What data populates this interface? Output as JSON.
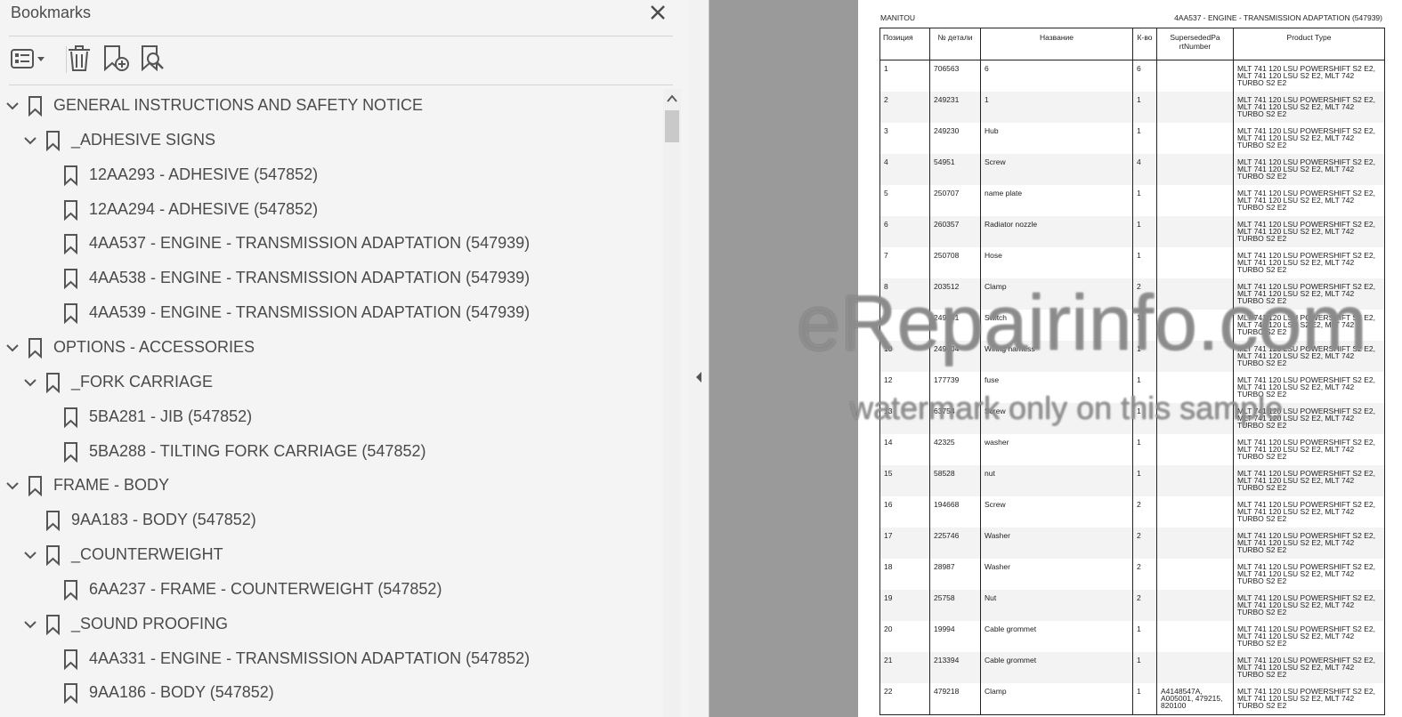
{
  "sidebar": {
    "title": "Bookmarks",
    "toolbar": {
      "options_icon": "list-options-icon",
      "delete_icon": "trash-icon",
      "add_icon": "bookmark-add-icon",
      "find_icon": "bookmark-find-icon"
    },
    "items": [
      {
        "level": 0,
        "expandable": true,
        "label": "GENERAL INSTRUCTIONS AND SAFETY NOTICE"
      },
      {
        "level": 1,
        "expandable": true,
        "label": "_ADHESIVE SIGNS"
      },
      {
        "level": 2,
        "expandable": false,
        "label": "12AA293 - ADHESIVE (547852)"
      },
      {
        "level": 2,
        "expandable": false,
        "label": "12AA294 - ADHESIVE (547852)"
      },
      {
        "level": 2,
        "expandable": false,
        "label": "4AA537 - ENGINE - TRANSMISSION ADAPTATION (547939)"
      },
      {
        "level": 2,
        "expandable": false,
        "label": "4AA538 - ENGINE - TRANSMISSION ADAPTATION (547939)"
      },
      {
        "level": 2,
        "expandable": false,
        "label": "4AA539 - ENGINE - TRANSMISSION ADAPTATION (547939)"
      },
      {
        "level": 0,
        "expandable": true,
        "label": "OPTIONS - ACCESSORIES"
      },
      {
        "level": 1,
        "expandable": true,
        "label": "_FORK CARRIAGE"
      },
      {
        "level": 2,
        "expandable": false,
        "label": "5BA281 - JIB (547852)"
      },
      {
        "level": 2,
        "expandable": false,
        "label": "5BA288 - TILTING FORK CARRIAGE (547852)"
      },
      {
        "level": 0,
        "expandable": true,
        "label": "FRAME - BODY"
      },
      {
        "level": 1,
        "expandable": false,
        "label": "9AA183 - BODY (547852)"
      },
      {
        "level": 1,
        "expandable": true,
        "label": "_COUNTERWEIGHT"
      },
      {
        "level": 2,
        "expandable": false,
        "label": "6AA237 - FRAME - COUNTERWEIGHT (547852)"
      },
      {
        "level": 1,
        "expandable": true,
        "label": "_SOUND PROOFING"
      },
      {
        "level": 2,
        "expandable": false,
        "label": "4AA331 - ENGINE - TRANSMISSION ADAPTATION (547852)"
      },
      {
        "level": 2,
        "expandable": false,
        "label": "9AA186 - BODY (547852)"
      }
    ]
  },
  "document": {
    "header_left": "MANITOU",
    "header_right": "4AA537 - ENGINE - TRANSMISSION ADAPTATION (547939)",
    "columns": [
      "Позиция",
      "№ детали",
      "Название",
      "К-во",
      "SupersededPa rtNumber",
      "Product Type"
    ],
    "rows": [
      [
        "1",
        "706563",
        "6",
        "6",
        "",
        "MLT 741 120 LSU POWERSHIFT S2 E2, MLT 741 120 LSU S2 E2, MLT 742 TURBO S2 E2"
      ],
      [
        "2",
        "249231",
        "1",
        "1",
        "",
        "MLT 741 120 LSU POWERSHIFT S2 E2, MLT 741 120 LSU S2 E2, MLT 742 TURBO S2 E2"
      ],
      [
        "3",
        "249230",
        "Hub",
        "1",
        "",
        "MLT 741 120 LSU POWERSHIFT S2 E2, MLT 741 120 LSU S2 E2, MLT 742 TURBO S2 E2"
      ],
      [
        "4",
        "54951",
        "Screw",
        "4",
        "",
        "MLT 741 120 LSU POWERSHIFT S2 E2, MLT 741 120 LSU S2 E2, MLT 742 TURBO S2 E2"
      ],
      [
        "5",
        "250707",
        "name plate",
        "1",
        "",
        "MLT 741 120 LSU POWERSHIFT S2 E2, MLT 741 120 LSU S2 E2, MLT 742 TURBO S2 E2"
      ],
      [
        "6",
        "260357",
        "Radiator nozzle",
        "1",
        "",
        "MLT 741 120 LSU POWERSHIFT S2 E2, MLT 741 120 LSU S2 E2, MLT 742 TURBO S2 E2"
      ],
      [
        "7",
        "250708",
        "Hose",
        "1",
        "",
        "MLT 741 120 LSU POWERSHIFT S2 E2, MLT 741 120 LSU S2 E2, MLT 742 TURBO S2 E2"
      ],
      [
        "8",
        "203512",
        "Clamp",
        "2",
        "",
        "MLT 741 120 LSU POWERSHIFT S2 E2, MLT 741 120 LSU S2 E2, MLT 742 TURBO S2 E2"
      ],
      [
        "9",
        "249341",
        "Switch",
        "1",
        "",
        "MLT 741 120 LSU POWERSHIFT S2 E2, MLT 741 120 LSU S2 E2, MLT 742 TURBO S2 E2"
      ],
      [
        "10",
        "249404",
        "Wiring harness",
        "1",
        "",
        "MLT 741 120 LSU POWERSHIFT S2 E2, MLT 741 120 LSU S2 E2, MLT 742 TURBO S2 E2"
      ],
      [
        "12",
        "177739",
        "fuse",
        "1",
        "",
        "MLT 741 120 LSU POWERSHIFT S2 E2, MLT 741 120 LSU S2 E2, MLT 742 TURBO S2 E2"
      ],
      [
        "13",
        "63754",
        "Screw",
        "1",
        "",
        "MLT 741 120 LSU POWERSHIFT S2 E2, MLT 741 120 LSU S2 E2, MLT 742 TURBO S2 E2"
      ],
      [
        "14",
        "42325",
        "washer",
        "1",
        "",
        "MLT 741 120 LSU POWERSHIFT S2 E2, MLT 741 120 LSU S2 E2, MLT 742 TURBO S2 E2"
      ],
      [
        "15",
        "58528",
        "nut",
        "1",
        "",
        "MLT 741 120 LSU POWERSHIFT S2 E2, MLT 741 120 LSU S2 E2, MLT 742 TURBO S2 E2"
      ],
      [
        "16",
        "194668",
        "Screw",
        "2",
        "",
        "MLT 741 120 LSU POWERSHIFT S2 E2, MLT 741 120 LSU S2 E2, MLT 742 TURBO S2 E2"
      ],
      [
        "17",
        "225746",
        "Washer",
        "2",
        "",
        "MLT 741 120 LSU POWERSHIFT S2 E2, MLT 741 120 LSU S2 E2, MLT 742 TURBO S2 E2"
      ],
      [
        "18",
        "28987",
        "Washer",
        "2",
        "",
        "MLT 741 120 LSU POWERSHIFT S2 E2, MLT 741 120 LSU S2 E2, MLT 742 TURBO S2 E2"
      ],
      [
        "19",
        "25758",
        "Nut",
        "2",
        "",
        "MLT 741 120 LSU POWERSHIFT S2 E2, MLT 741 120 LSU S2 E2, MLT 742 TURBO S2 E2"
      ],
      [
        "20",
        "19994",
        "Cable grommet",
        "1",
        "",
        "MLT 741 120 LSU POWERSHIFT S2 E2, MLT 741 120 LSU S2 E2, MLT 742 TURBO S2 E2"
      ],
      [
        "21",
        "213394",
        "Cable grommet",
        "1",
        "",
        "MLT 741 120 LSU POWERSHIFT S2 E2, MLT 741 120 LSU S2 E2, MLT 742 TURBO S2 E2"
      ],
      [
        "22",
        "479218",
        "Clamp",
        "1",
        "A4148547A, A005001, 479215, 820100",
        "MLT 741 120 LSU POWERSHIFT S2 E2, MLT 741 120 LSU S2 E2, MLT 742 TURBO S2 E2"
      ]
    ]
  },
  "watermark": {
    "main": "eRepairinfo.com",
    "sub": "watermark only on this sample"
  }
}
